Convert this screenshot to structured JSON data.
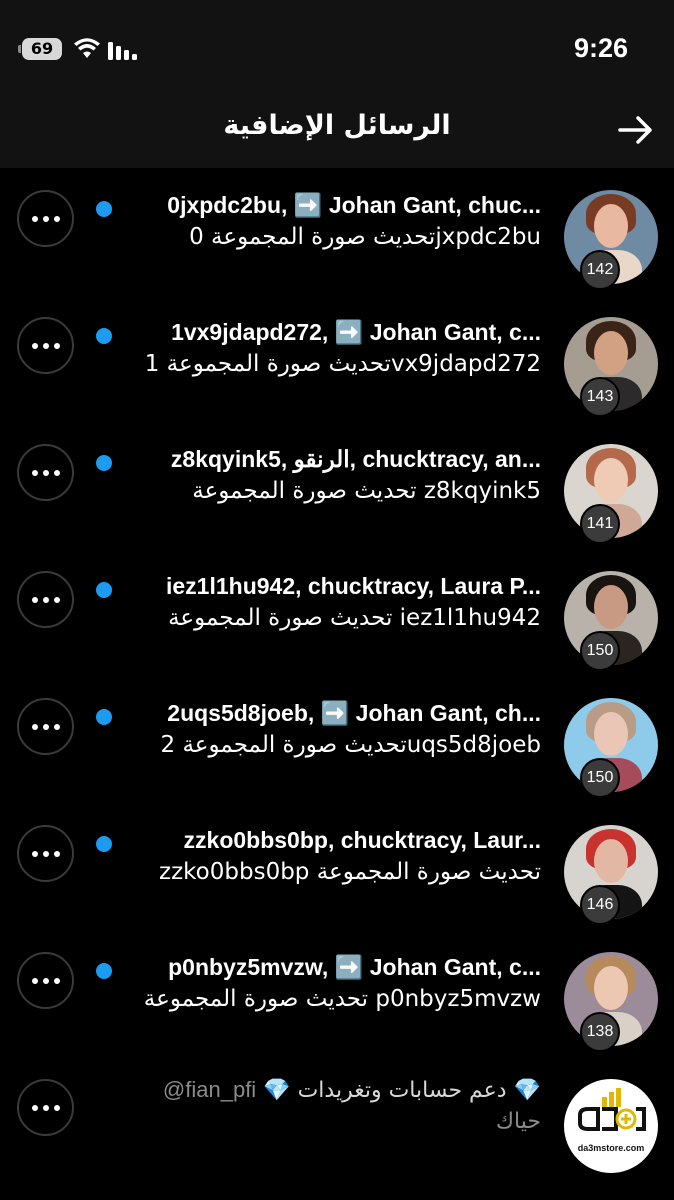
{
  "status": {
    "battery": "69",
    "time": "9:26"
  },
  "header": {
    "title": "الرسائل الإضافية"
  },
  "conversations": [
    {
      "line1": "0jxpdc2bu, ➡️ Johan Gant, chuc...",
      "line2": "تحديث صورة المجموعة 0jxpdc2bu",
      "badge": "142",
      "skin": "#e8b9a0",
      "hair": "#7a3b24",
      "body": "#e9d7c8",
      "bg": "#6f8aa3"
    },
    {
      "line1": "1vx9jdapd272, ➡️ Johan Gant, c...",
      "line2": "تحديث صورة المجموعة 1vx9jdapd272",
      "badge": "143",
      "skin": "#d2a184",
      "hair": "#3a2417",
      "body": "#2c2a2a",
      "bg": "#a69d92"
    },
    {
      "line1": "z8kqyink5, الرنقو, chucktracy, an...",
      "line2": "تحديث صورة المجموعة z8kqyink5",
      "badge": "141",
      "skin": "#efcab5",
      "hair": "#b46a4a",
      "body": "#cfa996",
      "bg": "#dad6cf"
    },
    {
      "line1": "iez1l1hu942, chucktracy, Laura P...",
      "line2": "تحديث صورة المجموعة iez1l1hu942",
      "badge": "150",
      "skin": "#c89a83",
      "hair": "#1a1411",
      "body": "#2b2522",
      "bg": "#b8b2ab"
    },
    {
      "line1": "2uqs5d8joeb, ➡️ Johan Gant, ch...",
      "line2": "تحديث صورة المجموعة 2uqs5d8joeb",
      "badge": "150",
      "skin": "#e9c6b5",
      "hair": "#b89c86",
      "body": "#a64b5a",
      "bg": "#8ecbea"
    },
    {
      "line1": "zzko0bbs0bp, chucktracy, Laur...",
      "line2": "zzko0bbs0bp تحديث صورة المجموعة",
      "badge": "146",
      "skin": "#e2b8a5",
      "hair": "#c8322f",
      "body": "#141414",
      "bg": "#d7d4cf"
    },
    {
      "line1": "p0nbyz5mvzw, ➡️ Johan Gant, c...",
      "line2": "تحديث صورة المجموعة p0nbyz5mvzw",
      "badge": "138",
      "skin": "#ecc7b2",
      "hair": "#b78a5e",
      "body": "#d9d0c8",
      "bg": "#9c8c99"
    }
  ],
  "promo": {
    "text": "💎 دعم حسابات وتغريدات 💎",
    "handle": "@fian_pfi",
    "line2": "حياك",
    "logo_text": "da3mstore.com"
  }
}
